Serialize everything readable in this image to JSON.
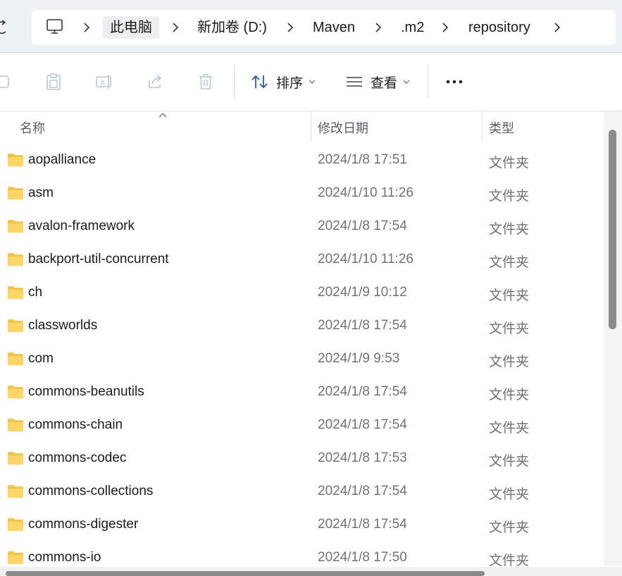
{
  "address_bar": {
    "breadcrumbs": [
      "此电脑",
      "新加卷 (D:)",
      "Maven",
      ".m2",
      "repository"
    ]
  },
  "toolbar": {
    "sort_label": "排序",
    "view_label": "查看"
  },
  "columns": {
    "name": "名称",
    "date": "修改日期",
    "type": "类型"
  },
  "files": [
    {
      "name": "aopalliance",
      "date": "2024/1/8 17:51",
      "type": "文件夹"
    },
    {
      "name": "asm",
      "date": "2024/1/10 11:26",
      "type": "文件夹"
    },
    {
      "name": "avalon-framework",
      "date": "2024/1/8 17:54",
      "type": "文件夹"
    },
    {
      "name": "backport-util-concurrent",
      "date": "2024/1/10 11:26",
      "type": "文件夹"
    },
    {
      "name": "ch",
      "date": "2024/1/9 10:12",
      "type": "文件夹"
    },
    {
      "name": "classworlds",
      "date": "2024/1/8 17:54",
      "type": "文件夹"
    },
    {
      "name": "com",
      "date": "2024/1/9 9:53",
      "type": "文件夹"
    },
    {
      "name": "commons-beanutils",
      "date": "2024/1/8 17:54",
      "type": "文件夹"
    },
    {
      "name": "commons-chain",
      "date": "2024/1/8 17:54",
      "type": "文件夹"
    },
    {
      "name": "commons-codec",
      "date": "2024/1/8 17:53",
      "type": "文件夹"
    },
    {
      "name": "commons-collections",
      "date": "2024/1/8 17:54",
      "type": "文件夹"
    },
    {
      "name": "commons-digester",
      "date": "2024/1/8 17:54",
      "type": "文件夹"
    },
    {
      "name": "commons-io",
      "date": "2024/1/8 17:50",
      "type": "文件夹"
    }
  ]
}
